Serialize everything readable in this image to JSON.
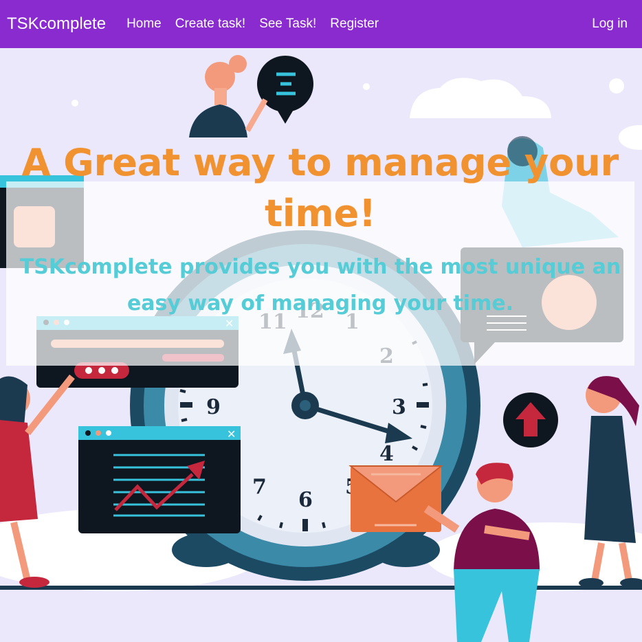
{
  "navbar": {
    "brand": "TSKcomplete",
    "links": [
      "Home",
      "Create task!",
      "See Task!",
      "Register"
    ],
    "login": "Log in",
    "color": "#8a2bd0"
  },
  "hero": {
    "headline": "A Great way to manage your time!",
    "subtext": "TSKcomplete provides you with the most unique an easy way of managing your time.",
    "headline_color": "#f0922f",
    "subtext_color": "#55ccd6",
    "clock_numbers": [
      "11",
      "12",
      "1",
      "2",
      "3",
      "4",
      "5",
      "6",
      "7",
      "9"
    ]
  }
}
